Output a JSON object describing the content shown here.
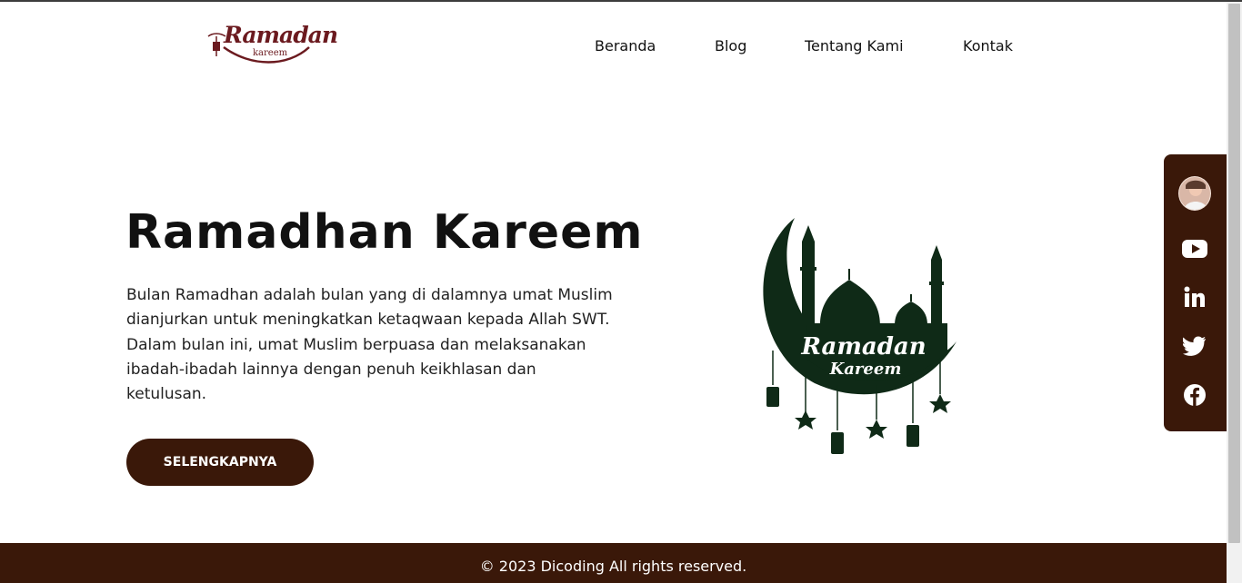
{
  "header": {
    "logo_text": "Ramadan",
    "logo_subtext": "kareem",
    "nav": [
      "Beranda",
      "Blog",
      "Tentang Kami",
      "Kontak"
    ]
  },
  "hero": {
    "title": "Ramadhan Kareem",
    "description": "Bulan Ramadhan adalah bulan yang di dalamnya umat Muslim dianjurkan untuk meningkatkan ketaqwaan kepada Allah SWT. Dalam bulan ini, umat Muslim berpuasa dan melaksanakan ibadah-ibadah lainnya dengan penuh keikhlasan dan ketulusan.",
    "cta_label": "SELENGKAPNYA",
    "illustration_text_1": "Ramadan",
    "illustration_text_2": "Kareem"
  },
  "social": {
    "icons": [
      "avatar",
      "youtube-icon",
      "linkedin-icon",
      "twitter-icon",
      "facebook-icon"
    ]
  },
  "footer": {
    "copyright": "© 2023 Dicoding All rights reserved."
  },
  "colors": {
    "brand_brown": "#3a1809",
    "logo_maroon": "#6b1a1f",
    "illustration_green": "#0f2a17"
  }
}
